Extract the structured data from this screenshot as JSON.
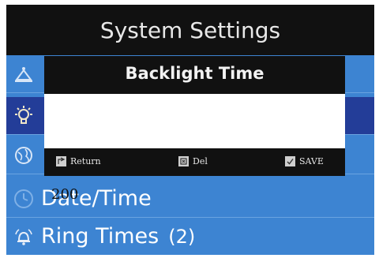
{
  "header": {
    "title": "System Settings"
  },
  "menu": {
    "items": [
      {
        "label": "",
        "icon": "bell-person-icon"
      },
      {
        "label": "",
        "icon": "lightbulb-icon",
        "selected": true
      },
      {
        "label": "",
        "icon": "globe-icon"
      },
      {
        "label": "Date/Time",
        "icon": "clock-icon"
      },
      {
        "label": "Ring Times",
        "count": "(2)",
        "icon": "ring-bell-icon"
      }
    ]
  },
  "dialog": {
    "title": "Backlight Time",
    "input_value": "",
    "softkeys": {
      "return_label": "Return",
      "del_label": "Del",
      "save_label": "SAVE"
    }
  },
  "overlay_value": "200",
  "colors": {
    "title_bar": "#111111",
    "menu_background": "#3d84d2",
    "menu_selected": "#233d98",
    "dialog_background": "#111111",
    "input_background": "#ffffff"
  }
}
